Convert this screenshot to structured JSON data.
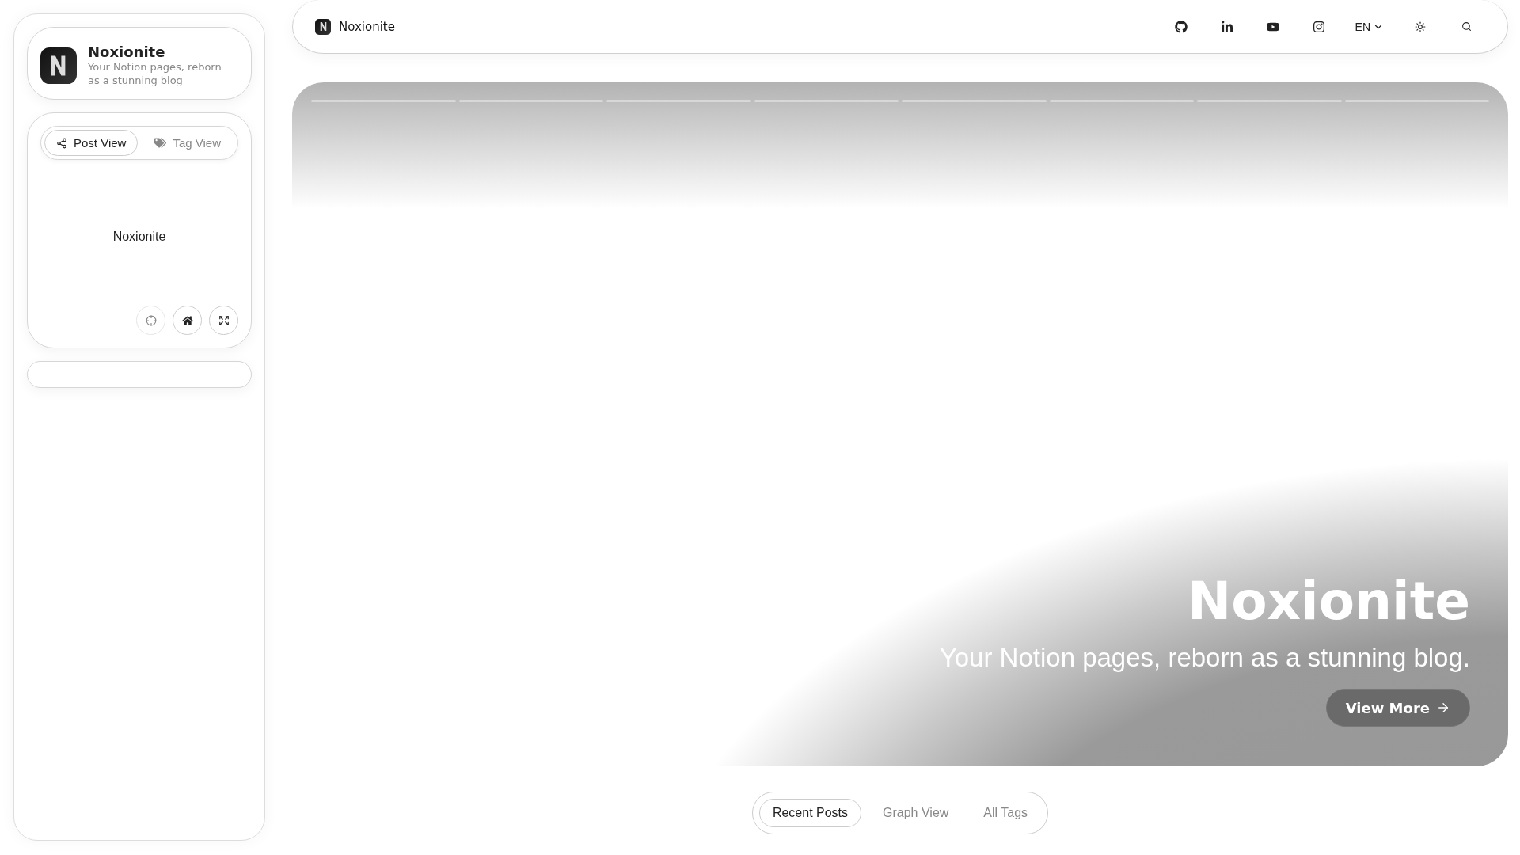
{
  "sidebar": {
    "profile": {
      "name": "Noxionite",
      "tagline": "Your Notion pages, reborn as a stunning blog"
    },
    "view_tabs": [
      {
        "label": "Post View",
        "selected": true
      },
      {
        "label": "Tag View",
        "selected": false
      }
    ],
    "graph_node": "Noxionite",
    "graph_controls": [
      {
        "active": false
      },
      {
        "active": true
      },
      {
        "active": true
      }
    ]
  },
  "header": {
    "brand": "Noxionite",
    "language": "EN"
  },
  "hero": {
    "title": "Noxionite",
    "subtitle": "Your Notion pages, reborn as a stunning blog.",
    "button": "View More"
  },
  "bottom_tabs": [
    {
      "label": "Recent Posts",
      "selected": true
    },
    {
      "label": "Graph View",
      "selected": false
    },
    {
      "label": "All Tags",
      "selected": false
    }
  ]
}
